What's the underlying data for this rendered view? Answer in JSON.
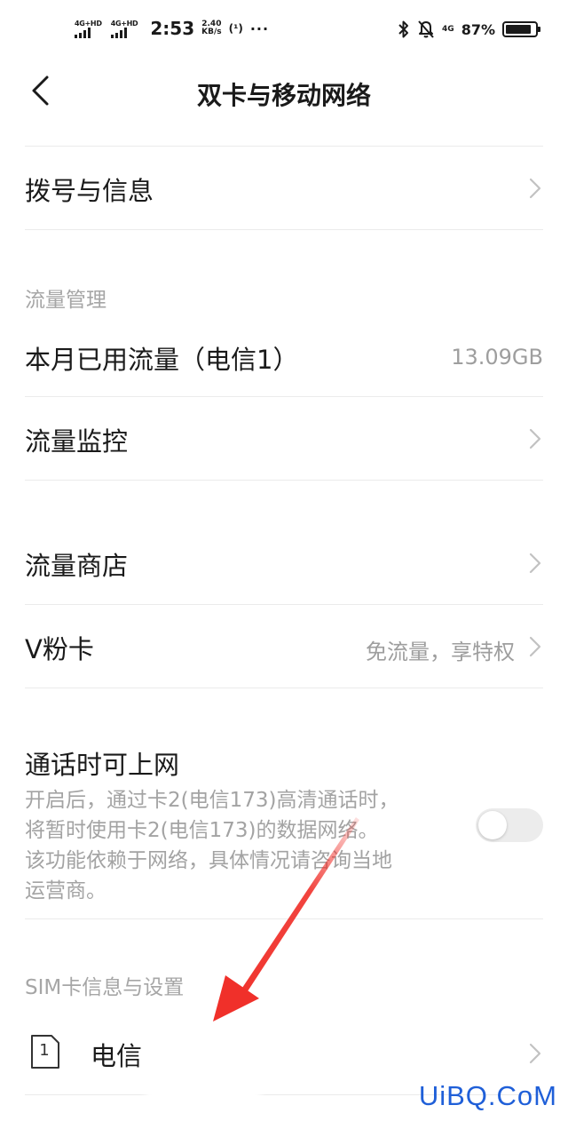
{
  "status_bar": {
    "sim1_tag": "4G+HD",
    "sim2_tag": "4G+HD",
    "time": "2:53",
    "speed_value": "2.40",
    "speed_unit": "KB/s",
    "hotspot": "(¹)",
    "more": "···",
    "network_right": "4G",
    "battery_percent": "87%",
    "battery_level": 0.87,
    "icons": [
      "bluetooth-icon",
      "bell-muted-icon",
      "battery-icon"
    ]
  },
  "header": {
    "title": "双卡与移动网络",
    "back_icon": "chevron-left-icon"
  },
  "items": {
    "dial_messages": {
      "label": "拨号与信息"
    },
    "data_section": {
      "title": "流量管理"
    },
    "monthly_usage": {
      "label": "本月已用流量（电信1）",
      "value": "13.09GB"
    },
    "data_monitor": {
      "label": "流量监控"
    },
    "data_store": {
      "label": "流量商店"
    },
    "v_card": {
      "label": "V粉卡",
      "value": "免流量，享特权"
    },
    "call_internet": {
      "label": "通话时可上网",
      "description_lines": [
        "开启后，通过卡2(电信173)高清通话时，",
        "将暂时使用卡2(电信173)的数据网络。",
        "该功能依赖于网络，具体情况请咨询当地",
        "运营商。"
      ],
      "enabled": false
    },
    "sim_section": {
      "title": "SIM卡信息与设置"
    },
    "sim1": {
      "slot": "1",
      "label": "电信"
    }
  },
  "watermark": "UiBQ.CoM",
  "colors": {
    "text_primary": "#1a1a1a",
    "text_secondary": "#9e9e9e",
    "divider": "#ebebeb",
    "arrow": "#f0302a",
    "watermark": "#1f5fd8"
  }
}
